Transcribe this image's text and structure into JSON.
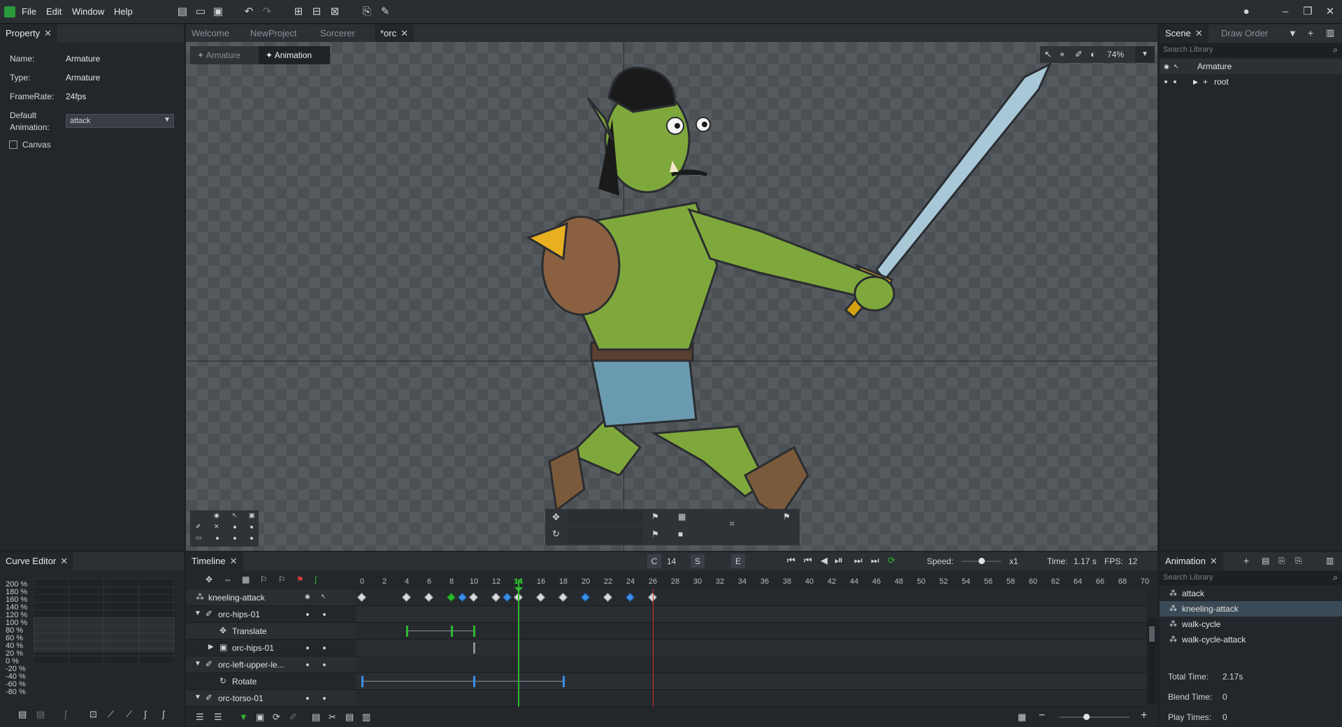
{
  "menu": {
    "file": "File",
    "edit": "Edit",
    "window": "Window",
    "help": "Help"
  },
  "property": {
    "tab": "Property",
    "name_label": "Name:",
    "name": "Armature",
    "type_label": "Type:",
    "type": "Armature",
    "framerate_label": "FrameRate:",
    "framerate": "24fps",
    "default_anim_label_1": "Default",
    "default_anim_label_2": "Animation:",
    "default_anim": "attack",
    "canvas_label": "Canvas"
  },
  "doc_tabs": [
    "Welcome",
    "NewProject",
    "Sorcerer",
    "*orc"
  ],
  "mode": {
    "armature": "Armature",
    "animation": "Animation"
  },
  "zoom": "74%",
  "scene": {
    "tab1": "Scene",
    "tab2": "Draw Order",
    "search_placeholder": "Search Library",
    "root_item": "Armature",
    "child_item": "root"
  },
  "curve_editor": {
    "tab": "Curve Editor",
    "scale": [
      "200 %",
      "180 %",
      "160 %",
      "140 %",
      "120 %",
      "100 %",
      "80 %",
      "60 %",
      "40 %",
      "20 %",
      "0 %",
      "-20 %",
      "-40 %",
      "-60 %",
      "-80 %"
    ]
  },
  "timeline": {
    "tab": "Timeline",
    "c_label": "C",
    "current": "14",
    "s_label": "S",
    "e_label": "E",
    "speed_label": "Speed:",
    "speed": "x1",
    "time_label": "Time:",
    "time": "1.17 s",
    "fps_label": "FPS:",
    "fps": "12",
    "ticks": [
      "0",
      "2",
      "4",
      "6",
      "8",
      "10",
      "12",
      "14",
      "16",
      "18",
      "20",
      "22",
      "24",
      "26",
      "28",
      "30",
      "32",
      "34",
      "36",
      "38",
      "40",
      "42",
      "44",
      "46",
      "48",
      "50",
      "52",
      "54",
      "56",
      "58",
      "60",
      "62",
      "64",
      "66",
      "68",
      "70"
    ],
    "tracks": [
      "kneeling-attack",
      "orc-hips-01",
      "Translate",
      "orc-hips-01",
      "orc-left-upper-le...",
      "Rotate",
      "orc-torso-01"
    ]
  },
  "animation": {
    "tab": "Animation",
    "search_placeholder": "Search Library",
    "items": [
      "attack",
      "kneeling-attack",
      "walk-cycle",
      "walk-cycle-attack"
    ],
    "total_time_label": "Total Time:",
    "total_time": "2.17s",
    "blend_time_label": "Blend Time:",
    "blend_time": "0",
    "play_times_label": "Play Times:",
    "play_times": "0"
  },
  "colors": {
    "accent_green": "#2db82d",
    "keyframe_blue": "#3a8fe8",
    "end_marker": "#d23030"
  }
}
